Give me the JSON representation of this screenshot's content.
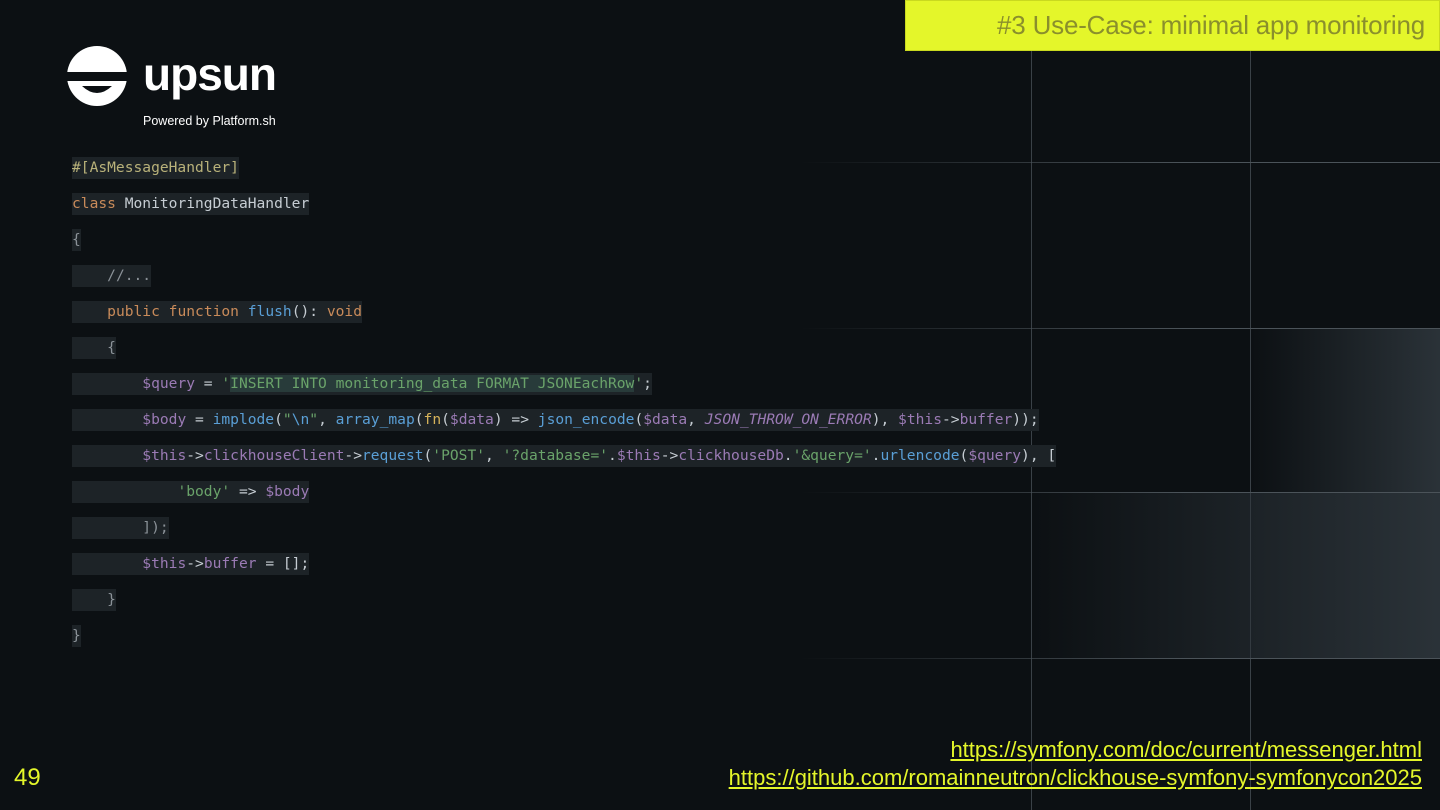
{
  "slide": {
    "title": "#3 Use-Case: minimal app monitoring",
    "page_number": "49"
  },
  "logo": {
    "name": "upsun",
    "tagline": "Powered by Platform.sh"
  },
  "code": {
    "l1": "#[AsMessageHandler]",
    "l2_kw": "class",
    "l2_name": " MonitoringDataHandler",
    "l3": "{",
    "l4_indent": "    ",
    "l4": "//...",
    "l5_indent": "    ",
    "l5_kw1": "public",
    "l5_kw2": "function",
    "l5_fn": "flush",
    "l5_rest": "(): ",
    "l5_void": "void",
    "l6_indent": "    ",
    "l6": "{",
    "l7_indent": "        ",
    "l7_var": "$query",
    "l7_eq": " = ",
    "l7_q1": "'",
    "l7_sel": "INSERT INTO monitoring_data FORMAT JSONEachRow",
    "l7_q2": "'",
    "l7_end": ";",
    "l8_indent": "        ",
    "l8_var": "$body",
    "l8_eq": " = ",
    "l8_implode": "implode",
    "l8_p1": "(",
    "l8_str1": "\"",
    "l8_esc": "\\n",
    "l8_str2": "\"",
    "l8_comma": ", ",
    "l8_arraymap": "array_map",
    "l8_p2": "(",
    "l8_fn": "fn",
    "l8_p3": "(",
    "l8_data": "$data",
    "l8_arrow": ") => ",
    "l8_json": "json_encode",
    "l8_p4": "(",
    "l8_data2": "$data",
    "l8_comma2": ", ",
    "l8_const": "JSON_THROW_ON_ERROR",
    "l8_close": "), ",
    "l8_this": "$this",
    "l8_arrow2": "->",
    "l8_buffer": "buffer",
    "l8_end": "));",
    "l9_indent": "        ",
    "l9_this": "$this",
    "l9_a1": "->",
    "l9_client": "clickhouseClient",
    "l9_a2": "->",
    "l9_request": "request",
    "l9_p": "(",
    "l9_post": "'POST'",
    "l9_c": ", ",
    "l9_s1": "'?database='",
    "l9_dot": ".",
    "l9_this2": "$this",
    "l9_a3": "->",
    "l9_db": "clickhouseDb",
    "l9_dot2": ".",
    "l9_s2": "'&query='",
    "l9_dot3": ".",
    "l9_urlencode": "urlencode",
    "l9_p2": "(",
    "l9_qv": "$query",
    "l9_end": "), [",
    "l10_indent": "            ",
    "l10_key": "'body'",
    "l10_arrow": " => ",
    "l10_val": "$body",
    "l11_indent": "        ",
    "l11": "]);",
    "l12_indent": "        ",
    "l12_this": "$this",
    "l12_arrow": "->",
    "l12_buffer": "buffer",
    "l12_end": " = [];",
    "l13_indent": "    ",
    "l13": "}",
    "l14": "}"
  },
  "links": {
    "messenger": "https://symfony.com/doc/current/messenger.html",
    "github": "https://github.com/romainneutron/clickhouse-symfony-symfonycon2025"
  },
  "colors": {
    "accent": "#e4f62a",
    "background": "#0c1013"
  }
}
